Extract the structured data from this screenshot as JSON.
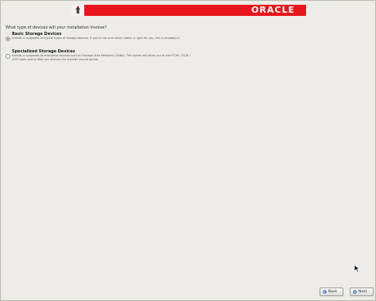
{
  "header": {
    "brand": "ORACLE",
    "logo_icon": "installer-logo-icon",
    "banner_color": "#e8151c"
  },
  "question": "What type of devices will your installation involve?",
  "options": [
    {
      "label": "Basic Storage Devices",
      "description": "Installs or upgrades to typical types of storage devices. If you're not sure which option is right for you, this is probably it.",
      "selected": true
    },
    {
      "label": "Specialized Storage Devices",
      "description": "Installs or upgrades to enterprise devices such as Storage Area Networks (SANs). This option will allow you to add FCoE / iSCSI / zFCP disks and to filter out devices the installer should ignore.",
      "selected": false
    }
  ],
  "footer": {
    "back_label": "Back",
    "next_label": "Next",
    "back_icon": "arrow-left-icon",
    "next_icon": "arrow-right-icon"
  }
}
